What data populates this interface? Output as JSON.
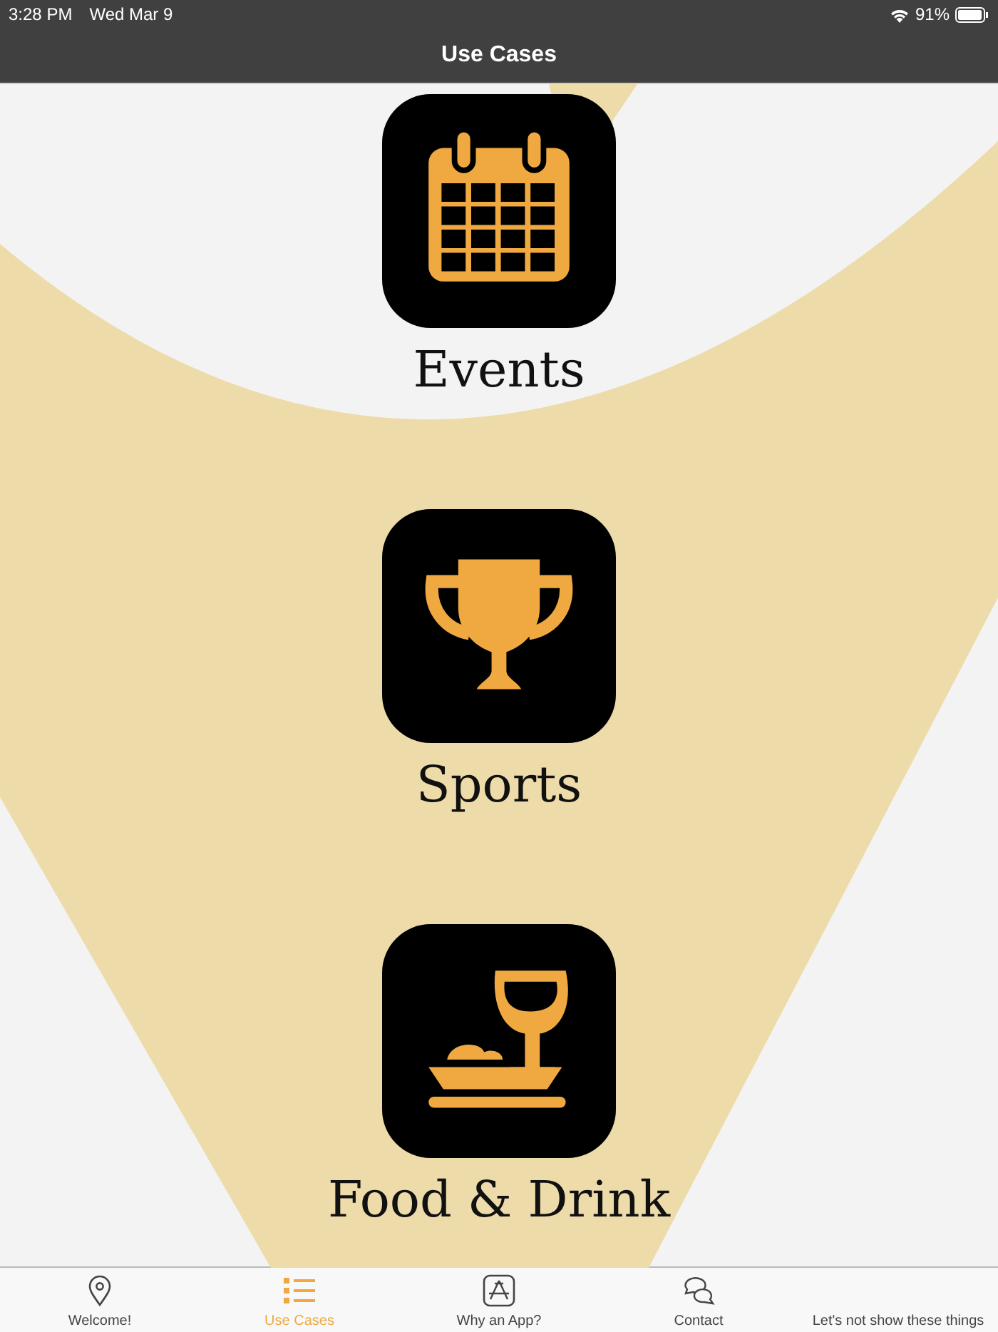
{
  "status_bar": {
    "time": "3:28 PM",
    "date": "Wed Mar 9",
    "battery": "91%"
  },
  "nav_bar": {
    "title": "Use Cases"
  },
  "use_cases": [
    {
      "label": "Events"
    },
    {
      "label": "Sports"
    },
    {
      "label": "Food & Drink"
    }
  ],
  "tab_bar": [
    {
      "label": "Welcome!",
      "selected": false
    },
    {
      "label": "Use Cases",
      "selected": true
    },
    {
      "label": "Why an App?",
      "selected": false
    },
    {
      "label": "Contact",
      "selected": false
    },
    {
      "label": "Let's not show these things",
      "selected": false
    }
  ]
}
